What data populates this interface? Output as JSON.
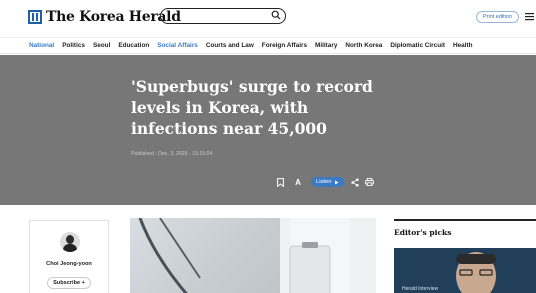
{
  "header": {
    "logo_text": "The Korea Herald",
    "search": {
      "placeholder": ""
    },
    "print_edition_label": "Print edition"
  },
  "nav": {
    "items": [
      {
        "label": "National",
        "active": true
      },
      {
        "label": "Politics",
        "active": false
      },
      {
        "label": "Seoul",
        "active": false
      },
      {
        "label": "Education",
        "active": false
      },
      {
        "label": "Social Affairs",
        "active": true
      },
      {
        "label": "Courts and Law",
        "active": false
      },
      {
        "label": "Foreign Affairs",
        "active": false
      },
      {
        "label": "Military",
        "active": false
      },
      {
        "label": "North Korea",
        "active": false
      },
      {
        "label": "Diplomatic Circuit",
        "active": false
      },
      {
        "label": "Health",
        "active": false
      }
    ]
  },
  "article": {
    "headline": "'Superbugs' surge to record levels in Korea, with infections near 45,000",
    "published": "Published : Dec. 3, 2025 - 15:15:04",
    "listen_label": "Listen"
  },
  "author": {
    "name": "Choi Jeong-yoon",
    "subscribe_label": "Subscribe +"
  },
  "sidebar": {
    "title": "Editor's picks",
    "pick_label": "Herald Interview"
  },
  "colors": {
    "accent": "#3b7bc4",
    "hero_bg": "#777777"
  }
}
